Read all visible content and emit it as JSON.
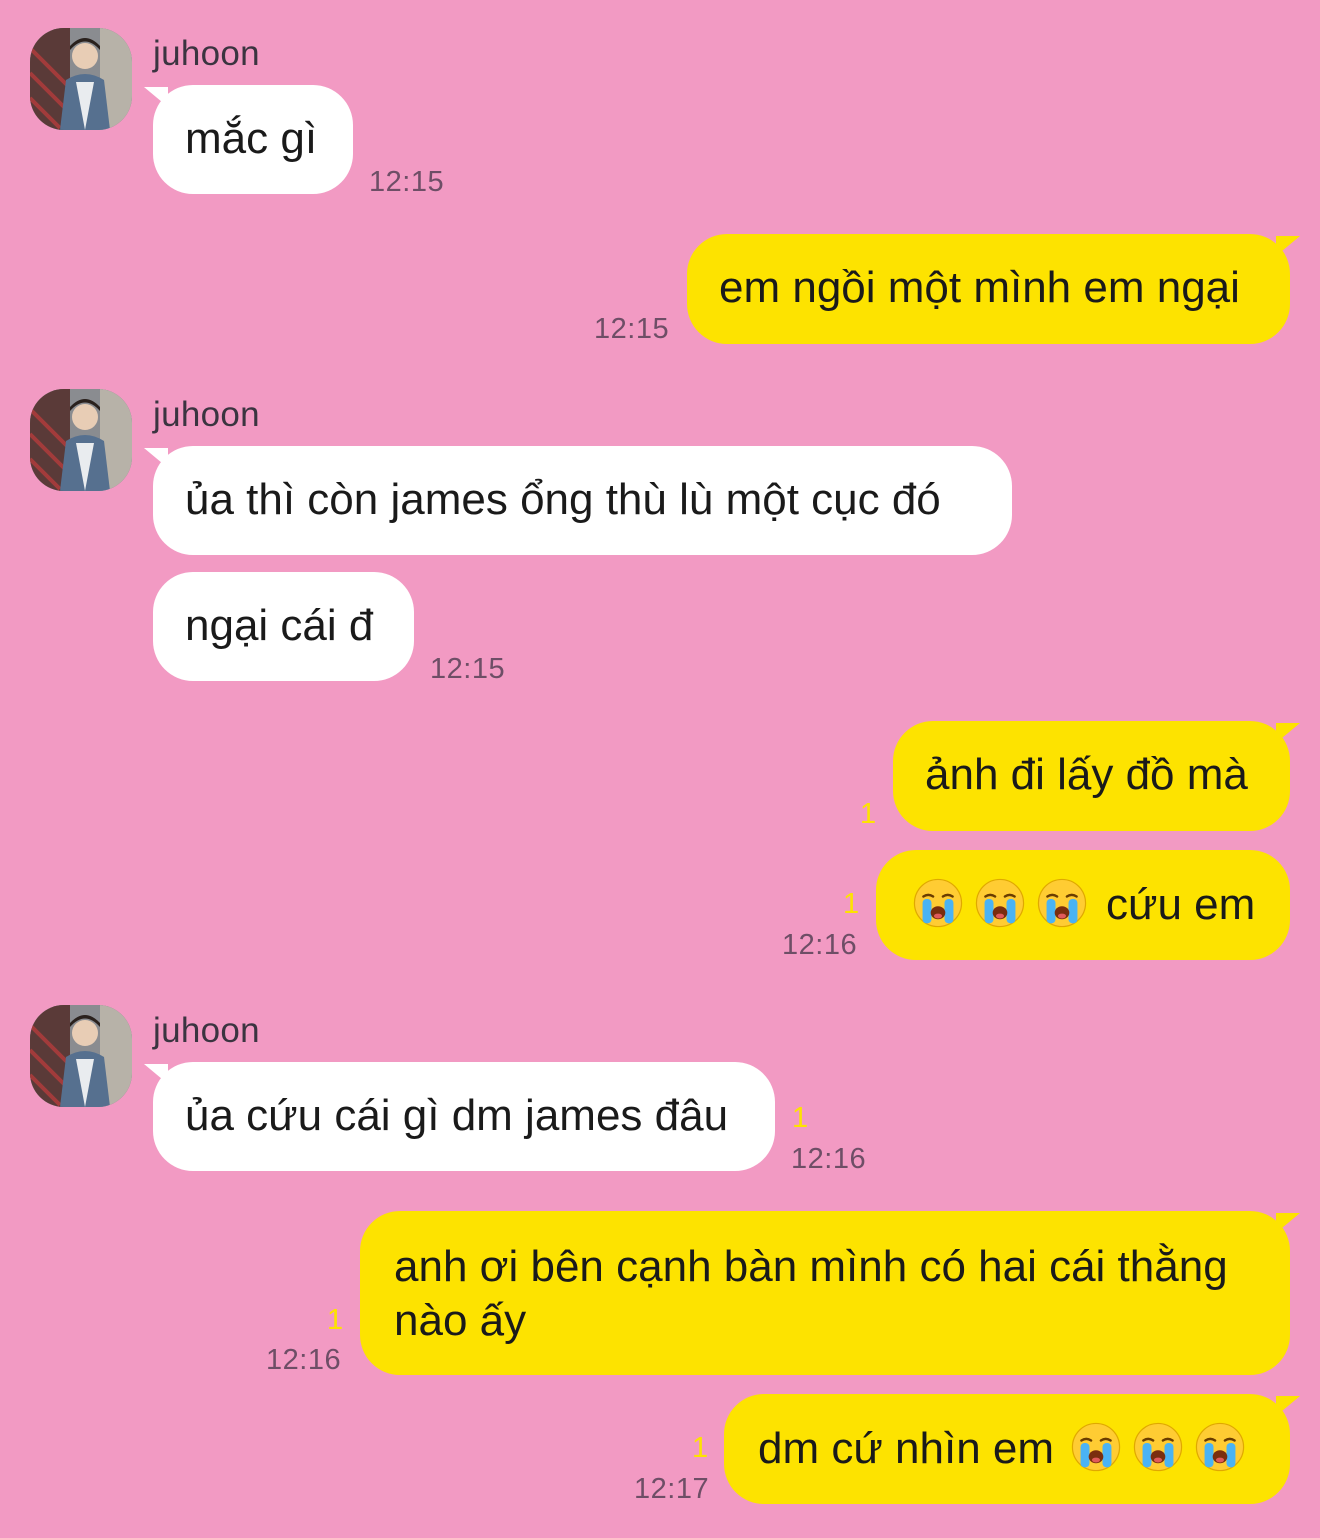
{
  "conversation": {
    "colors": {
      "background": "#f29ac3",
      "incoming_bubble": "#ffffff",
      "outgoing_bubble": "#fde300",
      "unread_count": "#fde300"
    },
    "messages": [
      {
        "sender": "juhoon",
        "direction": "incoming",
        "avatar_icon": "profile-photo",
        "bubbles": [
          {
            "text": "mắc gì"
          }
        ],
        "time": "12:15"
      },
      {
        "direction": "outgoing",
        "bubbles": [
          {
            "text": "em ngồi một mình em ngại"
          }
        ],
        "time": "12:15"
      },
      {
        "sender": "juhoon",
        "direction": "incoming",
        "avatar_icon": "profile-photo",
        "bubbles": [
          {
            "text": "ủa thì còn james ổng thù lù một cục đó"
          },
          {
            "text": "ngại cái đ"
          }
        ],
        "time": "12:15"
      },
      {
        "direction": "outgoing",
        "bubbles": [
          {
            "text": "ảnh đi lấy đồ mà",
            "unread": "1"
          },
          {
            "emoji": "loudly-crying-face",
            "emoji_count": 3,
            "text": "cứu em",
            "unread": "1"
          }
        ],
        "time": "12:16"
      },
      {
        "sender": "juhoon",
        "direction": "incoming",
        "avatar_icon": "profile-photo",
        "bubbles": [
          {
            "text": "ủa cứu cái gì dm james đâu",
            "unread": "1"
          }
        ],
        "time": "12:16"
      },
      {
        "direction": "outgoing",
        "bubbles": [
          {
            "text": "anh ơi bên cạnh bàn mình có hai cái thằng nào ấy",
            "unread": "1"
          }
        ],
        "time": "12:16"
      },
      {
        "direction": "outgoing",
        "bubbles": [
          {
            "text": "dm cứ nhìn em",
            "emoji": "loudly-crying-face",
            "emoji_count": 3,
            "unread": "1"
          }
        ],
        "time": "12:17"
      }
    ]
  }
}
